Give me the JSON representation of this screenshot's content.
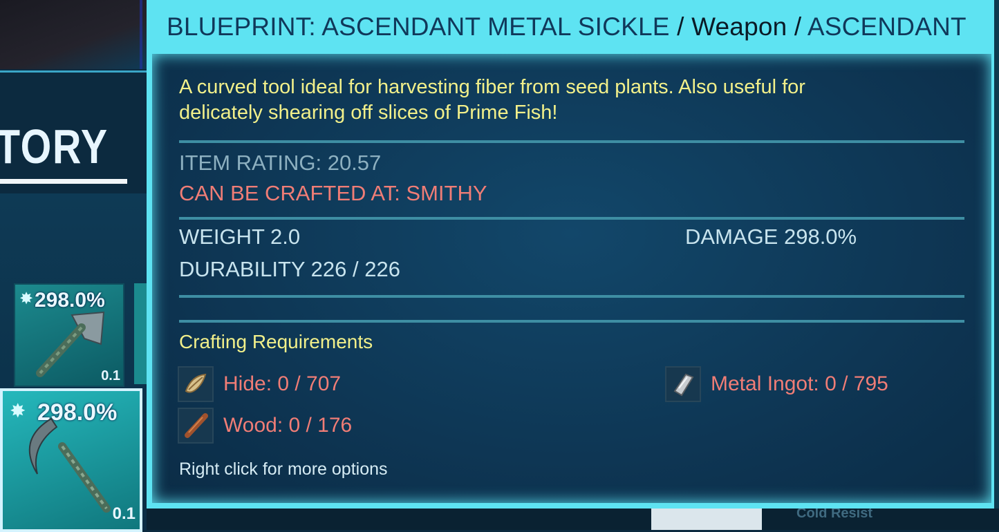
{
  "background": {
    "inventory_title": "TORY",
    "slots": [
      {
        "pct": "298.0%",
        "weight": "0.1"
      },
      {
        "pct": "298.0%",
        "weight": "0.1"
      }
    ],
    "cold_label": "Cold Resist"
  },
  "tooltip": {
    "title": {
      "name": "BLUEPRINT: ASCENDANT METAL SICKLE",
      "sep1": " / ",
      "category": "Weapon",
      "sep2": " / ",
      "quality": "ASCENDANT"
    },
    "description": "A curved tool ideal for harvesting fiber from seed plants. Also useful for delicately shearing off slices of Prime Fish!",
    "item_rating": "ITEM RATING: 20.57",
    "crafted_at": "CAN BE CRAFTED AT: SMITHY",
    "weight": "WEIGHT 2.0",
    "durability": "DURABILITY 226 / 226",
    "damage": "DAMAGE 298.0%",
    "requirements_heading": "Crafting Requirements",
    "requirements": [
      {
        "label": "Hide: 0 / 707",
        "icon": "hide-icon"
      },
      {
        "label": "Wood: 0 / 176",
        "icon": "wood-icon"
      },
      {
        "label": "Metal Ingot: 0 / 795",
        "icon": "metal-ingot-icon"
      }
    ],
    "hint": "Right click for more options"
  },
  "colors": {
    "tooltip_frame": "#5ee3f2",
    "tooltip_body": "#0d3350",
    "description_text": "#f2f08a",
    "warning_text": "#f07d76",
    "stat_text": "#c8e4ee"
  }
}
